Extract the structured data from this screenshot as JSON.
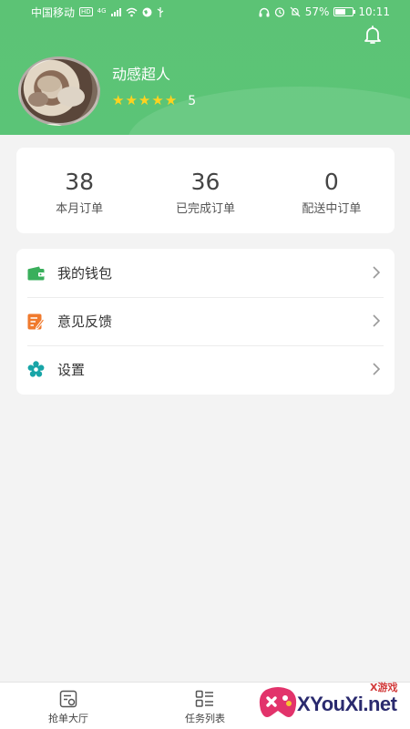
{
  "status_bar": {
    "carrier": "中国移动",
    "hd_badge": "HD",
    "network": "4G",
    "battery_percent": "57%",
    "battery_level": 0.57,
    "time": "10:11"
  },
  "header": {
    "notification_icon": "bell-icon",
    "user_name": "动感超人",
    "rating_stars": 5,
    "rating_value": "5",
    "colors": {
      "header_green": "#5cc375",
      "star_yellow": "#ffd21f"
    }
  },
  "stats": [
    {
      "value": "38",
      "label": "本月订单"
    },
    {
      "value": "36",
      "label": "已完成订单"
    },
    {
      "value": "0",
      "label": "配送中订单"
    }
  ],
  "menu": [
    {
      "label": "我的钱包",
      "icon": "wallet-icon",
      "color": "#3aaf5c"
    },
    {
      "label": "意见反馈",
      "icon": "feedback-icon",
      "color": "#f07a2d"
    },
    {
      "label": "设置",
      "icon": "settings-gear-icon",
      "color": "#18a5a7"
    }
  ],
  "tabbar": [
    {
      "label": "抢单大厅",
      "icon": "order-hall-icon"
    },
    {
      "label": "任务列表",
      "icon": "task-list-icon"
    }
  ],
  "watermark": {
    "small_text": "X游戏",
    "main_text": "XYouXi.net"
  }
}
